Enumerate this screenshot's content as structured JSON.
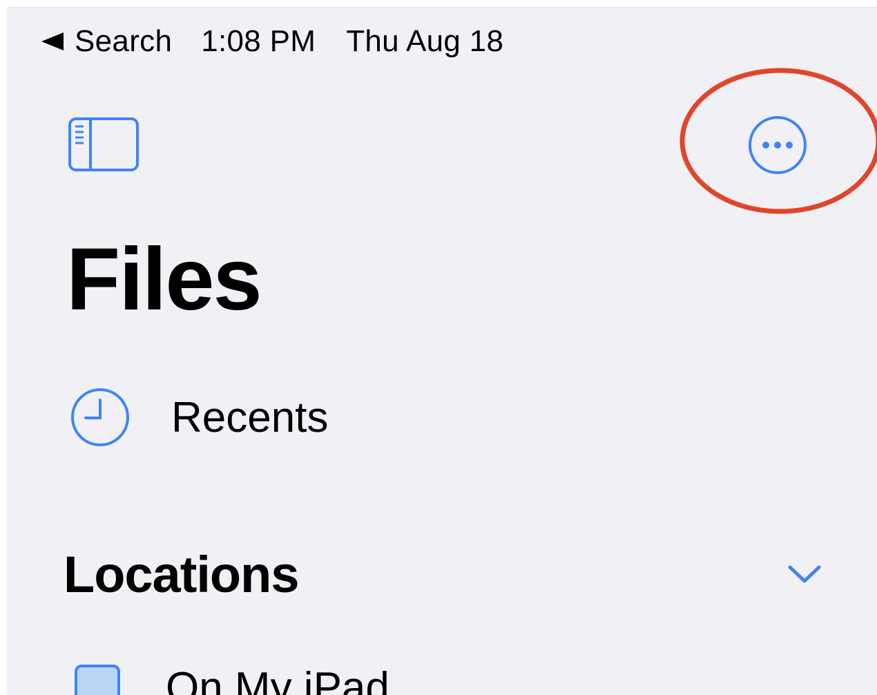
{
  "status_bar": {
    "back_label": "Search",
    "time": "1:08 PM",
    "date": "Thu Aug 18"
  },
  "toolbar": {
    "sidebar_toggle_icon": "sidebar-left-icon",
    "more_icon": "ellipsis-circle-icon"
  },
  "header": {
    "title": "Files"
  },
  "recents": {
    "label": "Recents",
    "icon": "clock-icon"
  },
  "locations": {
    "title": "Locations",
    "chevron_icon": "chevron-down-icon",
    "items": [
      {
        "label": "On My iPad",
        "icon": "ipad-folder-icon"
      }
    ]
  },
  "colors": {
    "accent": "#3e84f7",
    "background": "#f1f0f5",
    "annotation": "#e0462a"
  }
}
